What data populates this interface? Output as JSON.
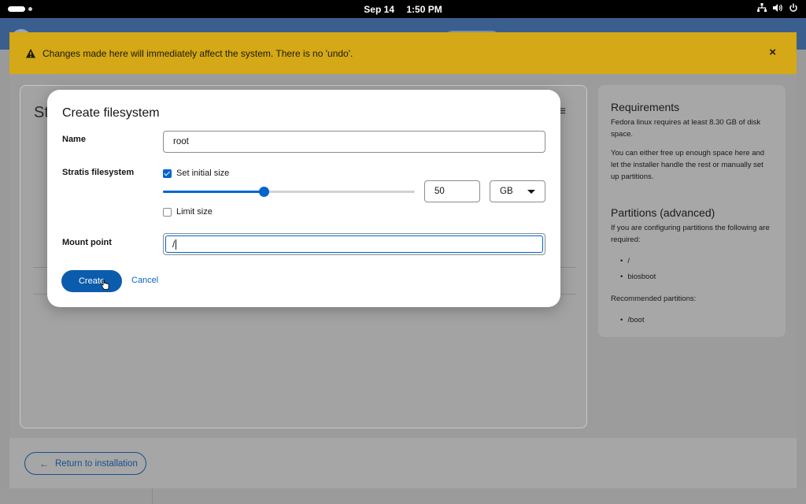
{
  "topbar": {
    "date": "Sep 14",
    "time": "1:50 PM",
    "tray_icons": [
      "network-icon",
      "volume-icon",
      "power-icon"
    ]
  },
  "warning": {
    "text": "Changes made here will immediately affect the system. There is no 'undo'.",
    "close": "×"
  },
  "background": {
    "left_card_title_partial": "St",
    "kebab": "≡"
  },
  "requirements": {
    "title": "Requirements",
    "text1": "Fedora linux requires at least 8.30 GB of disk space.",
    "text2": "You can either free up enough space here and let the installer handle the rest or manually set up partitions."
  },
  "partitions": {
    "title": "Partitions (advanced)",
    "intro": "If you are configuring partitions the following are required:",
    "required": [
      "/",
      "biosboot"
    ],
    "recommended_label": "Recommended partitions:",
    "recommended": [
      "/boot"
    ]
  },
  "footer": {
    "return_label": "Return to installation"
  },
  "dialog": {
    "title": "Create filesystem",
    "name_label": "Name",
    "name_value": "root",
    "stratis_label": "Stratis filesystem",
    "set_initial_size_label": "Set initial size",
    "set_initial_size_checked": true,
    "slider_fraction": 0.4,
    "size_value": "50",
    "unit_value": "GB",
    "limit_size_label": "Limit size",
    "limit_size_checked": false,
    "mount_label": "Mount point",
    "mount_value": "/",
    "create_label": "Create",
    "cancel_label": "Cancel"
  },
  "colors": {
    "accent": "#0066cc",
    "warning": "#d4a816",
    "primary_button": "#0b5cad"
  }
}
